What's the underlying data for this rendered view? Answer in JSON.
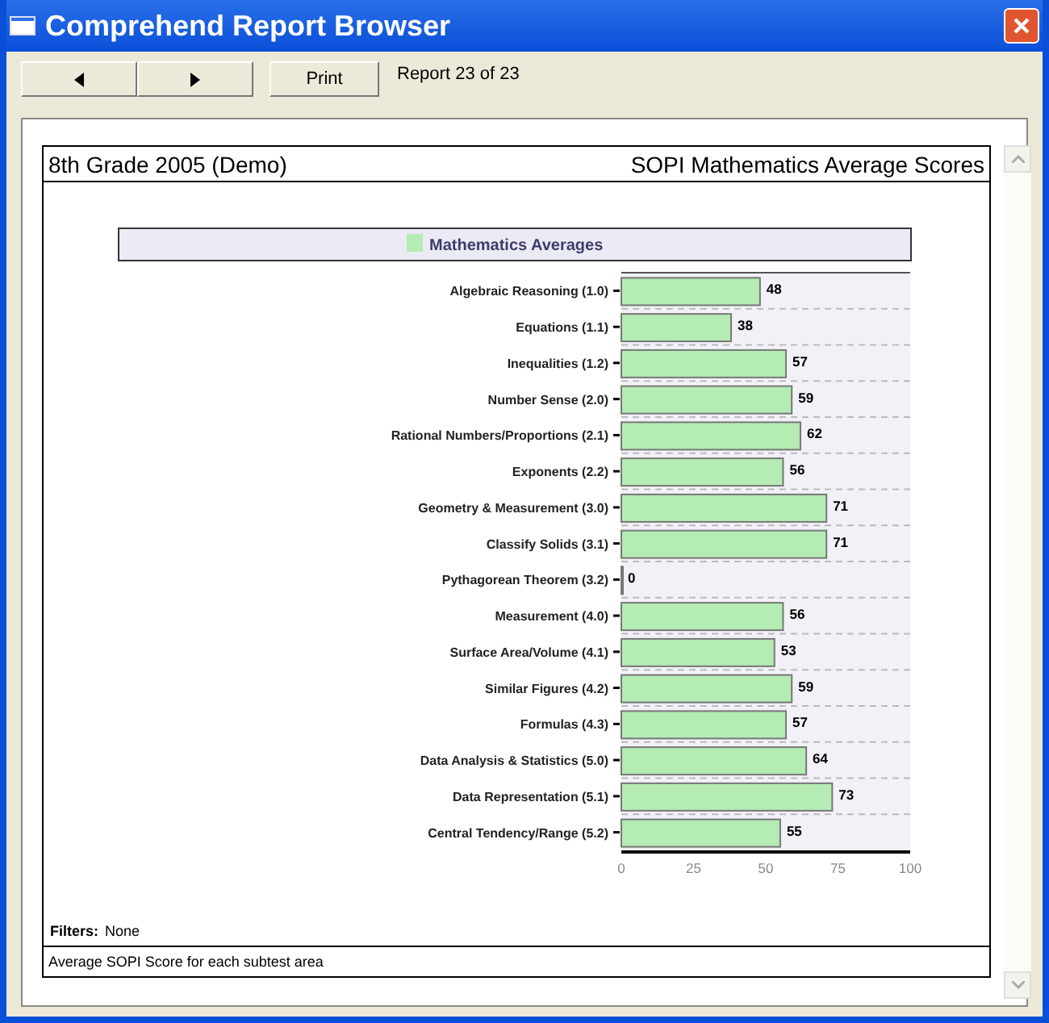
{
  "window": {
    "title": "Comprehend Report Browser"
  },
  "toolbar": {
    "print_label": "Print",
    "status": "Report 23 of 23"
  },
  "report": {
    "header_left": "8th Grade 2005 (Demo)",
    "header_right": "SOPI Mathematics Average Scores",
    "chart_data": {
      "type": "bar",
      "orientation": "horizontal",
      "categories": [
        "Algebraic Reasoning (1.0)",
        "Equations (1.1)",
        "Inequalities (1.2)",
        "Number Sense (2.0)",
        "Rational Numbers/Proportions (2.1)",
        "Exponents (2.2)",
        "Geometry & Measurement (3.0)",
        "Classify Solids (3.1)",
        "Pythagorean Theorem (3.2)",
        "Measurement (4.0)",
        "Surface Area/Volume (4.1)",
        "Similar Figures (4.2)",
        "Formulas (4.3)",
        "Data Analysis & Statistics (5.0)",
        "Data Representation (5.1)",
        "Central Tendency/Range (5.2)"
      ],
      "series": [
        {
          "name": "Mathematics Averages",
          "color": "#b4ecb4",
          "values": [
            48,
            38,
            57,
            59,
            62,
            56,
            71,
            71,
            0,
            56,
            53,
            59,
            57,
            64,
            73,
            55
          ]
        }
      ],
      "xlim": [
        0,
        100
      ],
      "xticks": [
        0,
        25,
        50,
        75,
        100
      ],
      "data_labels": true
    },
    "filters_label": "Filters:",
    "filters_value": "None",
    "caption": "Average SOPI Score for each subtest area"
  }
}
